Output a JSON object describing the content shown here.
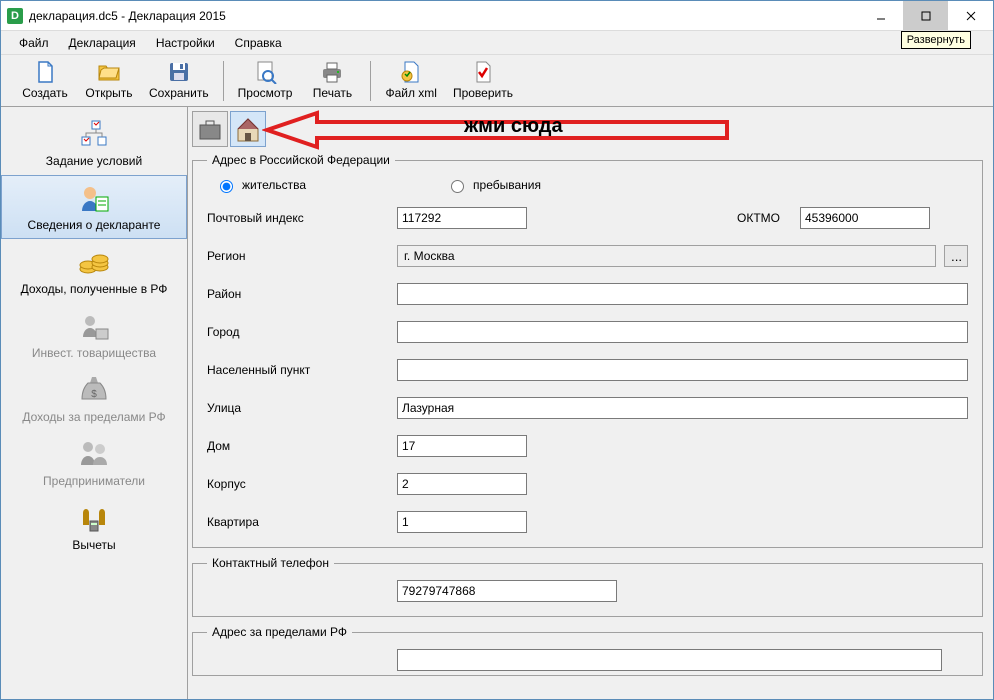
{
  "window": {
    "title": "декларация.dc5 - Декларация 2015",
    "tooltip": "Развернуть"
  },
  "menu": {
    "file": "Файл",
    "decl": "Декларация",
    "settings": "Настройки",
    "help": "Справка"
  },
  "toolbar": {
    "create": "Создать",
    "open": "Открыть",
    "save": "Сохранить",
    "preview": "Просмотр",
    "print": "Печать",
    "xml": "Файл xml",
    "check": "Проверить"
  },
  "sidebar": {
    "conditions": "Задание условий",
    "declarant": "Сведения о декларанте",
    "income_rf": "Доходы, полученные в РФ",
    "invest": "Инвест. товарищества",
    "income_abroad": "Доходы за пределами РФ",
    "entrepreneur": "Предприниматели",
    "deductions": "Вычеты"
  },
  "callout": "жми сюда",
  "address_rf": {
    "legend": "Адрес в Российской Федерации",
    "residence": "жительства",
    "stay": "пребывания",
    "postal_label": "Почтовый индекс",
    "postal_value": "117292",
    "oktmo_label": "ОКТМО",
    "oktmo_value": "45396000",
    "region_label": "Регион",
    "region_value": "г. Москва",
    "district_label": "Район",
    "district_value": "",
    "city_label": "Город",
    "city_value": "",
    "locality_label": "Населенный пункт",
    "locality_value": "",
    "street_label": "Улица",
    "street_value": "Лазурная",
    "house_label": "Дом",
    "house_value": "17",
    "building_label": "Корпус",
    "building_value": "2",
    "flat_label": "Квартира",
    "flat_value": "1"
  },
  "phone": {
    "legend": "Контактный телефон",
    "value": "79279747868"
  },
  "abroad": {
    "legend": "Адрес за пределами РФ",
    "value": ""
  }
}
